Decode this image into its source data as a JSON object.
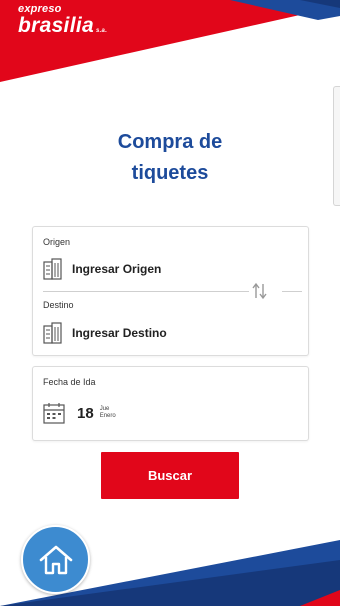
{
  "brand": {
    "line1": "expreso",
    "line2": "brasilia",
    "suffix": "s.a.",
    "colors": {
      "red": "#e1061a",
      "blue": "#1d4b9b",
      "home_blue": "#3d8bd0"
    }
  },
  "page": {
    "title_line1": "Compra de",
    "title_line2": "tiquetes"
  },
  "route": {
    "origin": {
      "label": "Origen",
      "value": "Ingresar Origen",
      "icon": "building-icon"
    },
    "destination": {
      "label": "Destino",
      "value": "Ingresar Destino",
      "icon": "building-icon"
    },
    "swap_icon": "swap-arrows-icon"
  },
  "date": {
    "label": "Fecha de Ida",
    "day": "18",
    "weekday": "Jue",
    "month": "Enero",
    "icon": "calendar-icon"
  },
  "actions": {
    "search_label": "Buscar"
  },
  "nav": {
    "home_icon": "home-icon"
  }
}
